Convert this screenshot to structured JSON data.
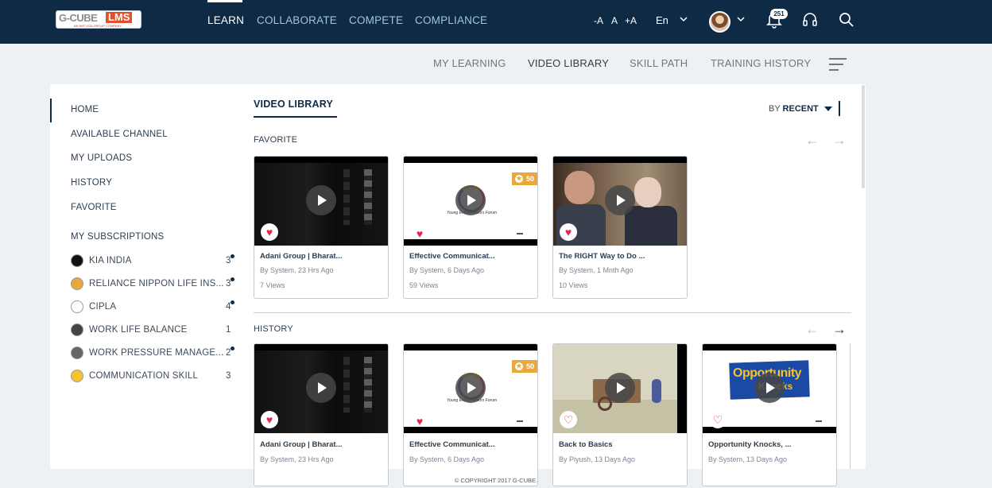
{
  "logo": {
    "brand": "G-CUBE",
    "product": "LMS",
    "tagline": "AN NIIT USA GROUP COMPANY"
  },
  "topnav": {
    "items": [
      "LEARN",
      "COLLABORATE",
      "COMPETE",
      "COMPLIANCE"
    ],
    "active": "LEARN"
  },
  "font_controls": [
    "-A",
    "A",
    "+A"
  ],
  "language": "En",
  "notifications": {
    "count": "251"
  },
  "icons": {
    "bell": "bell-icon",
    "support": "headset-icon",
    "search": "search-icon",
    "menu": "hamburger-icon"
  },
  "subnav": {
    "items": [
      "MY LEARNING",
      "VIDEO LIBRARY",
      "SKILL PATH",
      "TRAINING HISTORY"
    ],
    "active": "VIDEO LIBRARY"
  },
  "sidebar": {
    "items": [
      "HOME",
      "AVAILABLE CHANNEL",
      "MY UPLOADS",
      "HISTORY",
      "FAVORITE"
    ],
    "subscriptions_title": "MY SUBSCRIPTIONS",
    "subscriptions": [
      {
        "name": "KIA INDIA",
        "count": "3",
        "dot": true
      },
      {
        "name": "RELIANCE NIPPON LIFE INS...",
        "count": "3",
        "dot": true
      },
      {
        "name": "CIPLA",
        "count": "4",
        "dot": true
      },
      {
        "name": "WORK LIFE BALANCE",
        "count": "1",
        "dot": false
      },
      {
        "name": "WORK PRESSURE MANAGE...",
        "count": "2",
        "dot": true
      },
      {
        "name": "COMMUNICATION SKILL",
        "count": "3",
        "dot": false
      }
    ]
  },
  "main": {
    "title": "VIDEO LIBRARY",
    "sort": {
      "prefix": "BY",
      "value": "RECENT"
    },
    "favorite": {
      "title": "FAVORITE",
      "cards": [
        {
          "title": "Adani Group | Bharat...",
          "by": "By  System,  23 Hrs Ago",
          "views": "7 Views",
          "favorited": true
        },
        {
          "title": "Effective Communicat...",
          "by": "By  System,  6 Days Ago",
          "views": "59 Views",
          "favorited": true,
          "points": "50"
        },
        {
          "title": "The RIGHT Way to Do ...",
          "by": "By  System,  1 Mnth Ago",
          "views": "10 Views",
          "favorited": true
        }
      ]
    },
    "history": {
      "title": "HISTORY",
      "cards": [
        {
          "title": "Adani Group | Bharat...",
          "by": "By  System,  23 Hrs Ago",
          "favorited": true
        },
        {
          "title": "Effective Communicat...",
          "by": "By  System,  6 Days Ago",
          "favorited": true,
          "points": "50"
        },
        {
          "title": "Back to Basics",
          "by": "By  Piyush,  13 Days Ago",
          "favorited": false
        },
        {
          "title": "Opportunity Knocks, ...",
          "by": "By  System,  13 Days Ago",
          "favorited": false
        }
      ]
    },
    "thumb_text": {
      "yef": "Young Entrepreneurs Forum",
      "opp_line1": "Opportunity",
      "opp_line2": "Knocks"
    }
  },
  "arrows": {
    "prev": "←",
    "next": "→"
  },
  "footer": "© COPYRIGHT 2017 G-CUBE."
}
